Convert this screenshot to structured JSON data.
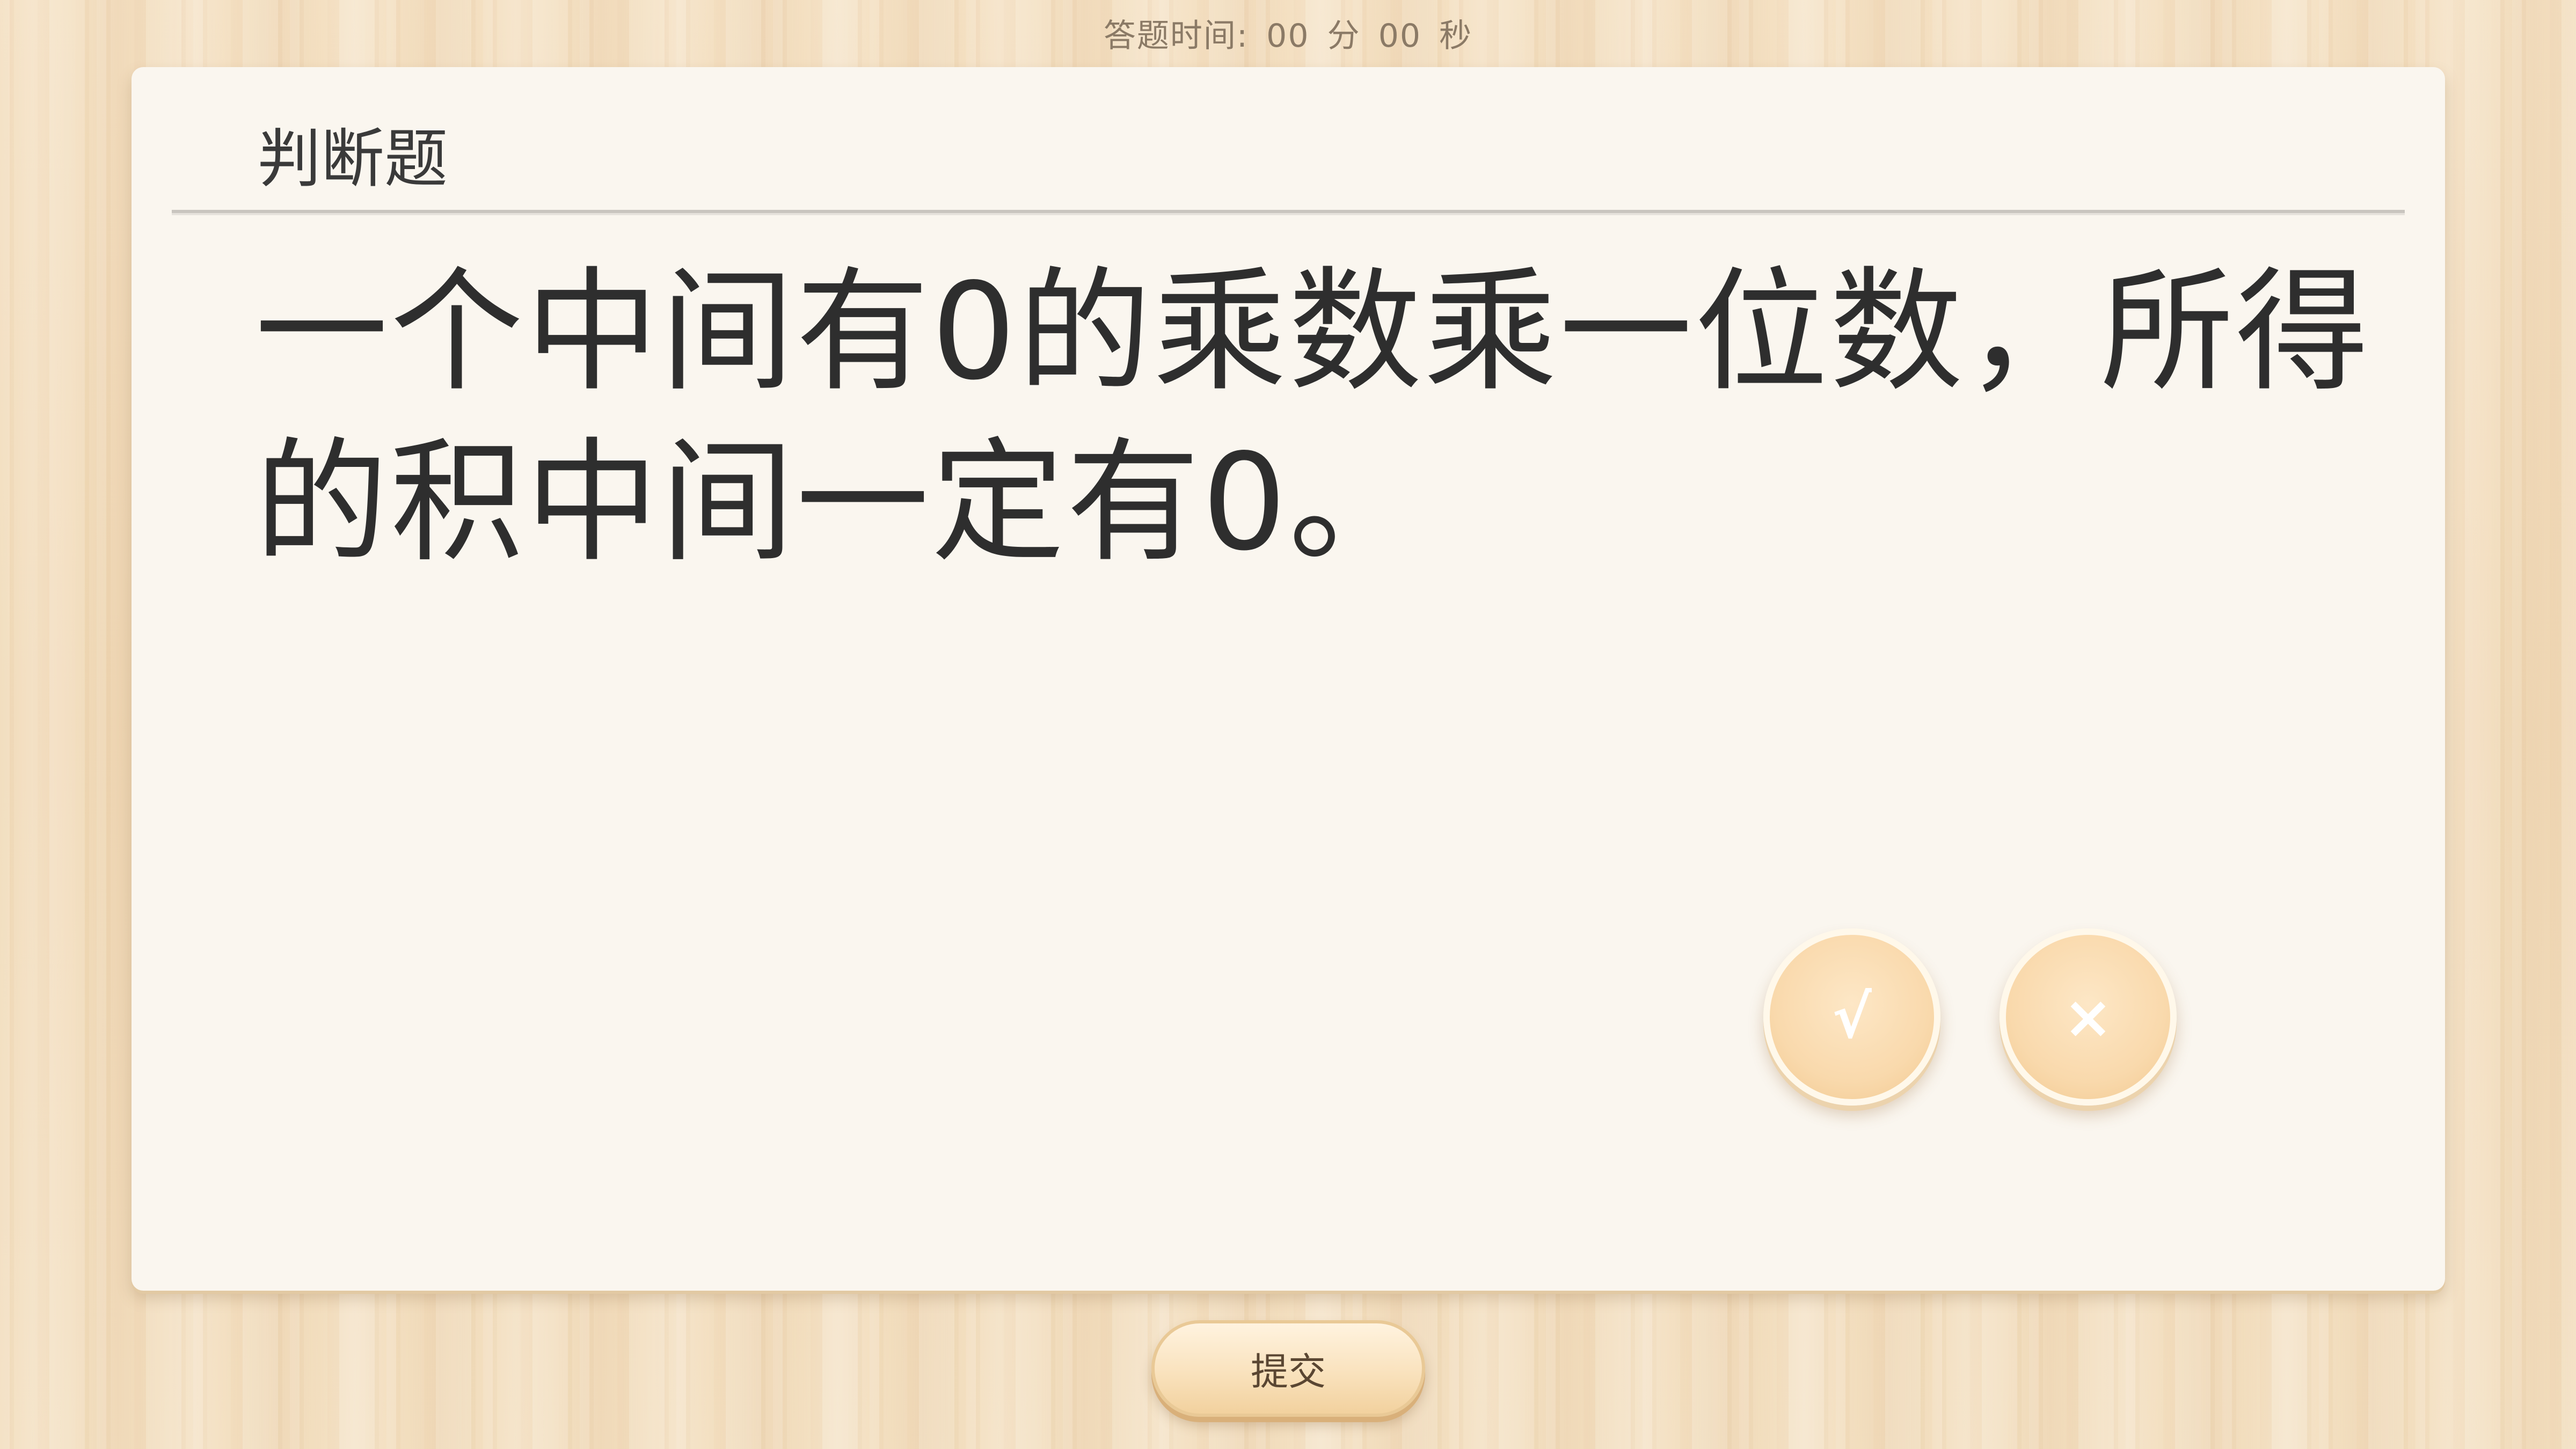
{
  "timer": {
    "label": "答题时间:",
    "minutes": "00",
    "minutes_unit": "分",
    "seconds": "00",
    "seconds_unit": "秒"
  },
  "question": {
    "type": "判断题",
    "text": "一个中间有0的乘数乘一位数，所得的积中间一定有0。"
  },
  "answers": {
    "true_label": "√",
    "false_label": "×"
  },
  "submit_label": "提交",
  "colors": {
    "card_background": "#faf6ef",
    "answer_button": "#f9d9ac",
    "submit_button": "#f9e2bd",
    "text": "#2e2e2e"
  }
}
